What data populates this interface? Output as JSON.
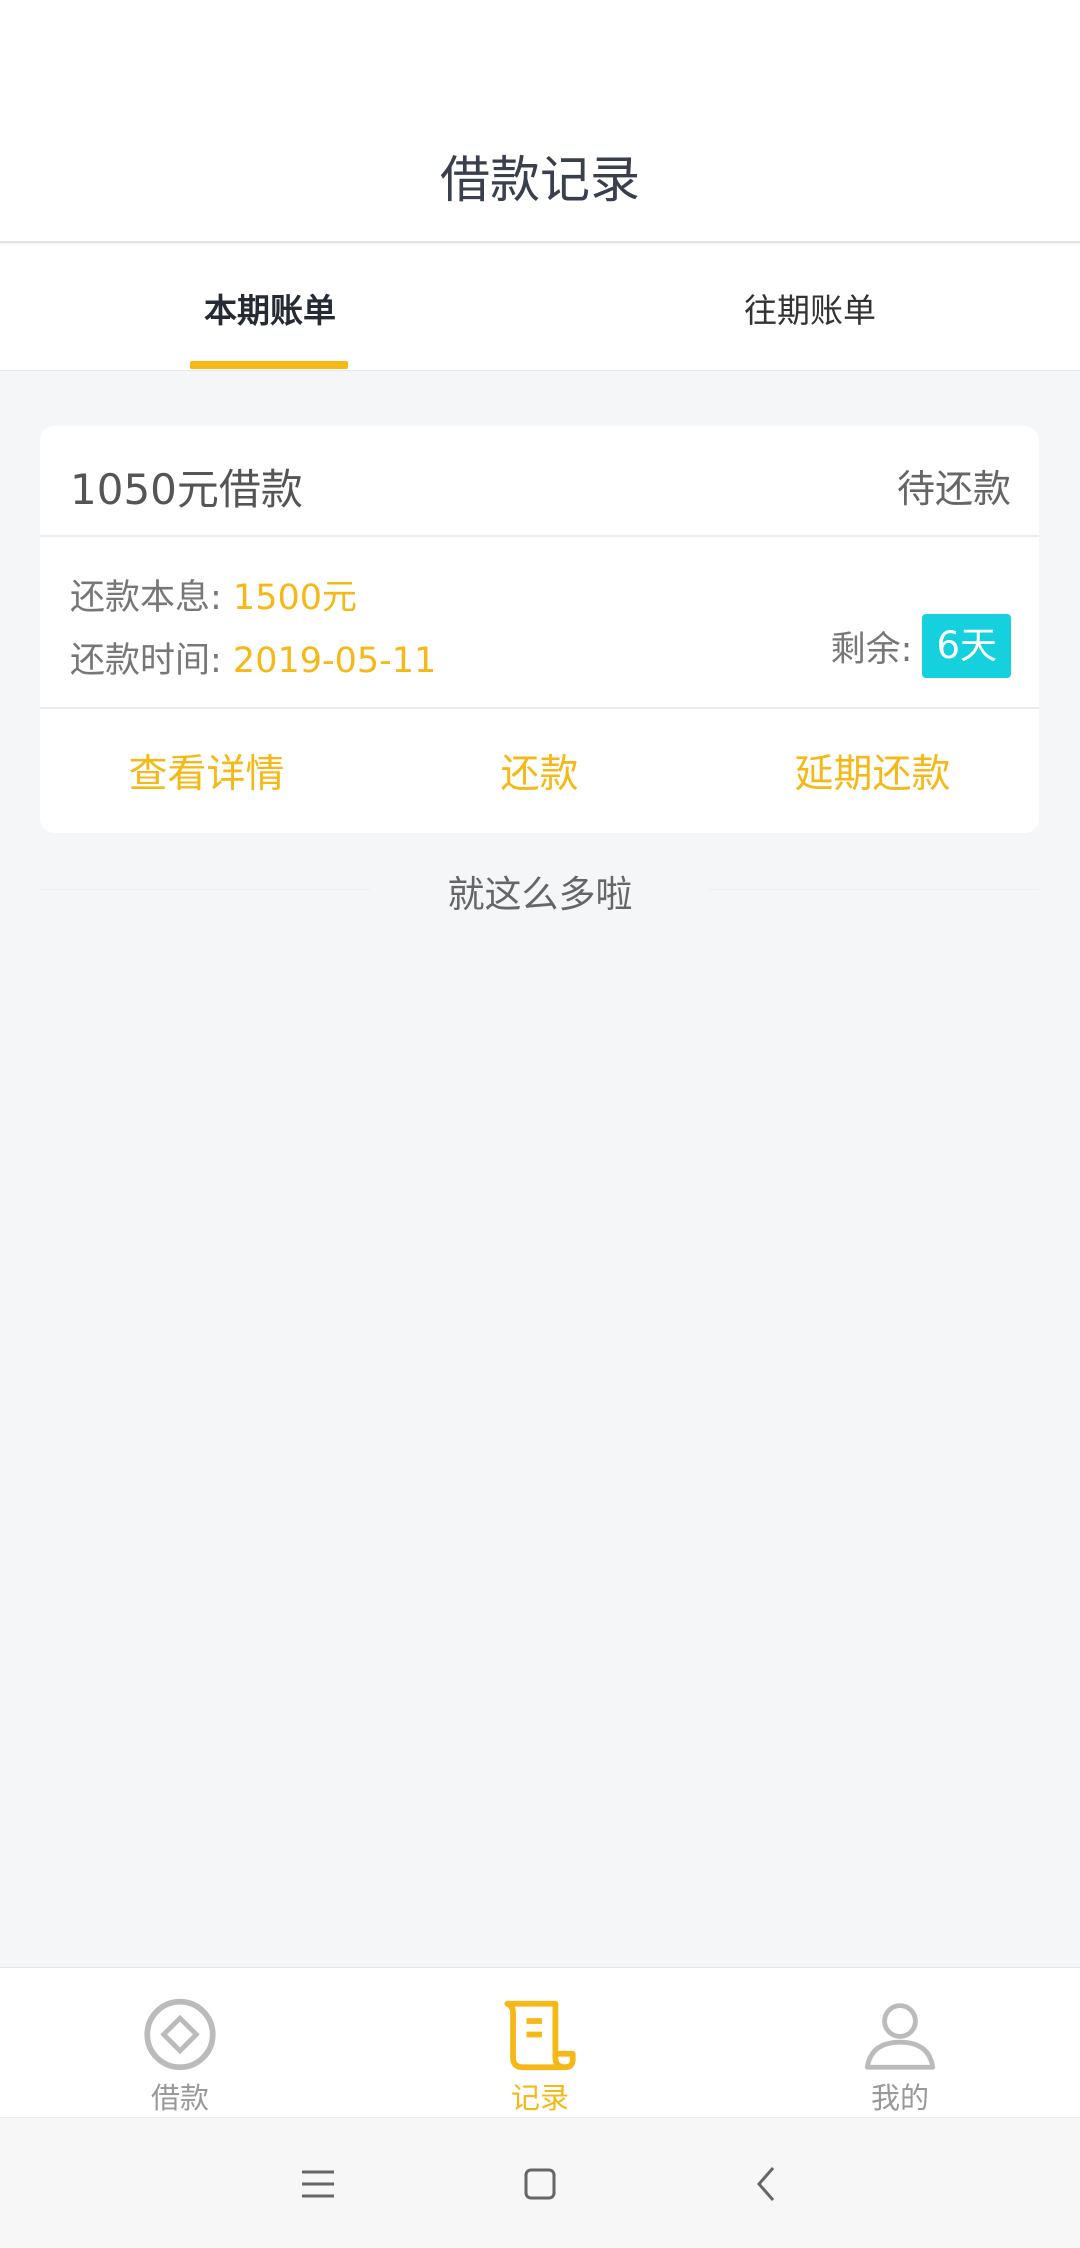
{
  "header": {
    "title": "借款记录"
  },
  "tabs": [
    {
      "label": "本期账单",
      "active": true
    },
    {
      "label": "往期账单",
      "active": false
    }
  ],
  "card": {
    "title": "1050元借款",
    "status": "待还款",
    "repay_amount_label": "还款本息: ",
    "repay_amount_value": "1500元",
    "repay_time_label": "还款时间: ",
    "repay_time_value": "2019-05-11",
    "remaining_label": "剩余:",
    "remaining_value": "6天",
    "actions": [
      "查看详情",
      "还款",
      "延期还款"
    ]
  },
  "end_note": "就这么多啦",
  "bottom_nav": [
    {
      "label": "借款",
      "icon": "loan-coin-icon",
      "active": false
    },
    {
      "label": "记录",
      "icon": "scroll-record-icon",
      "active": true
    },
    {
      "label": "我的",
      "icon": "user-profile-icon",
      "active": false
    }
  ],
  "colors": {
    "accent": "#f6b817",
    "badge": "#15d1dd",
    "background": "#f5f6f8"
  },
  "system_nav": [
    "menu-icon",
    "home-square-icon",
    "back-chevron-icon"
  ]
}
